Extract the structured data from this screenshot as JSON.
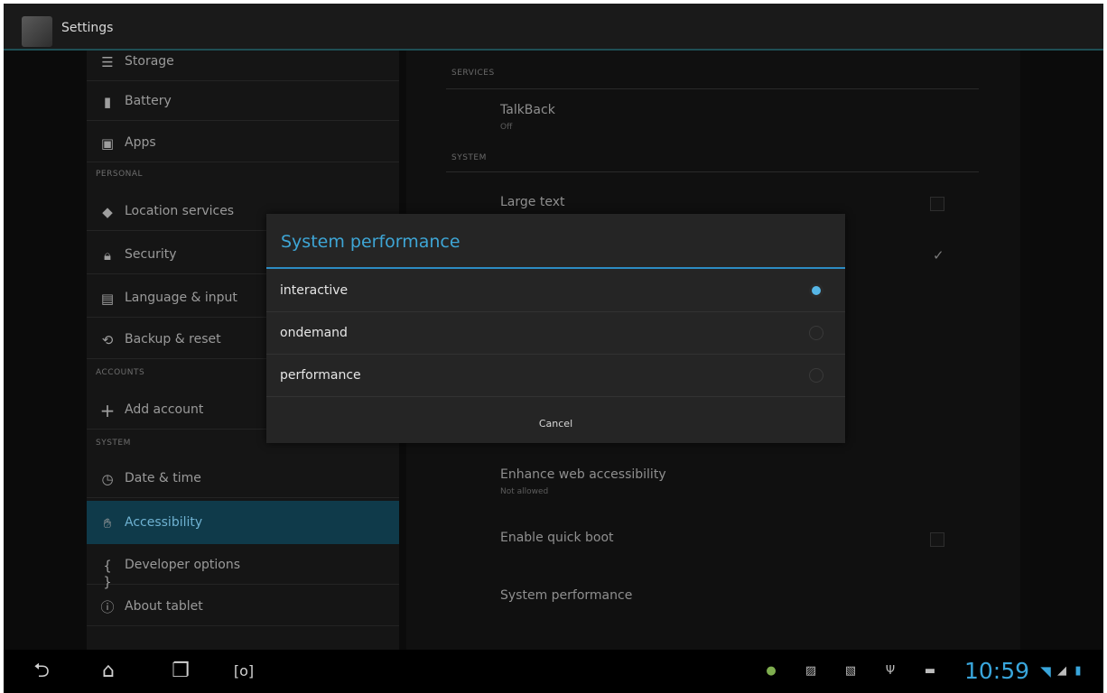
{
  "action_bar": {
    "title": "Settings"
  },
  "sidebar": {
    "items": [
      {
        "label": "Storage",
        "icon": "storage-icon"
      },
      {
        "label": "Battery",
        "icon": "battery-icon"
      },
      {
        "label": "Apps",
        "icon": "apps-icon"
      },
      {
        "label": "Location services",
        "icon": "location-icon"
      },
      {
        "label": "Security",
        "icon": "lock-icon"
      },
      {
        "label": "Language & input",
        "icon": "language-icon"
      },
      {
        "label": "Backup & reset",
        "icon": "backup-icon"
      },
      {
        "label": "Add account",
        "icon": "plus-icon"
      },
      {
        "label": "Date & time",
        "icon": "clock-icon"
      },
      {
        "label": "Accessibility",
        "icon": "hand-icon"
      },
      {
        "label": "Developer options",
        "icon": "braces-icon"
      },
      {
        "label": "About tablet",
        "icon": "info-icon"
      }
    ],
    "headers": {
      "personal": "PERSONAL",
      "accounts": "ACCOUNTS",
      "system": "SYSTEM"
    }
  },
  "content": {
    "services_header": "SERVICES",
    "system_header": "SYSTEM",
    "talkback": {
      "title": "TalkBack",
      "summary": "Off"
    },
    "large_text": "Large text",
    "enhance_web": {
      "title": "Enhance web accessibility",
      "summary": "Not allowed"
    },
    "quick_boot": "Enable quick boot",
    "system_performance": "System performance"
  },
  "dialog": {
    "title": "System performance",
    "options": [
      {
        "label": "interactive",
        "selected": true
      },
      {
        "label": "ondemand",
        "selected": false
      },
      {
        "label": "performance",
        "selected": false
      }
    ],
    "cancel_label": "Cancel"
  },
  "status_bar": {
    "time": "10:59"
  },
  "colors": {
    "accent": "#33b5e5",
    "selected_row": "#0f3a4a"
  }
}
